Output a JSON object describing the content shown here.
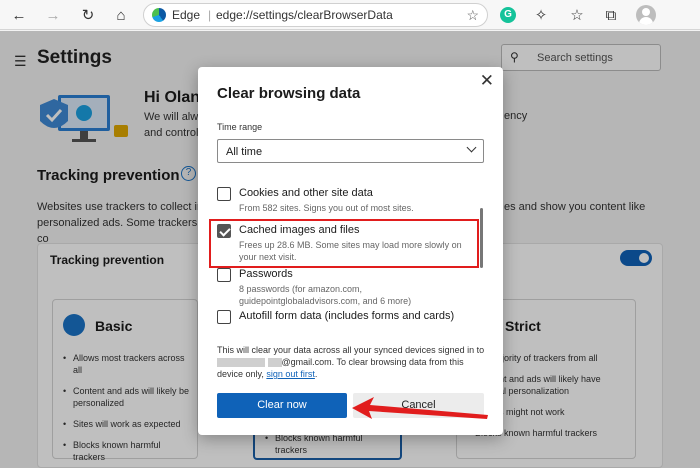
{
  "browser": {
    "brand": "Edge",
    "url": "edge://settings/clearBrowserData",
    "icons": [
      "back-icon",
      "forward-icon",
      "refresh-icon",
      "home-icon",
      "favorite-icon",
      "grammarly-icon",
      "extensions-icon",
      "favorites-icon",
      "collections-icon",
      "profile-icon"
    ],
    "grammarly_letter": "G"
  },
  "settings": {
    "title": "Settings",
    "search_placeholder": "Search settings",
    "greeting": "Hi Olan",
    "intro_text": "We will alw and control",
    "privacy_fragment": "ency",
    "tracking_heading": "Tracking prevention",
    "help_glyph": "?",
    "desc_left": "Websites use trackers to collect inf personalized ads. Some trackers co",
    "desc_right": "es and show you content like",
    "card_title": "Tracking prevention",
    "basic": {
      "title": "Basic",
      "items": [
        "Allows most trackers across all",
        "Content and ads will likely be personalized",
        "Sites will work as expected",
        "Blocks known harmful trackers"
      ]
    },
    "balanced": {
      "items": [
        "Blocks known harmful trackers"
      ]
    },
    "strict": {
      "title": "Strict",
      "items": [
        "s a majority of trackers from all",
        "Content and ads will likely have minimal personalization",
        "of sites might not work",
        "Blocks known harmful trackers"
      ]
    }
  },
  "dialog": {
    "title": "Clear browsing data",
    "time_range_label": "Time range",
    "time_range_value": "All time",
    "items": [
      {
        "title": "Cookies and other site data",
        "sub": "From 582 sites. Signs you out of most sites.",
        "checked": false
      },
      {
        "title": "Cached images and files",
        "sub": "Frees up 28.6 MB. Some sites may load more slowly on your next visit.",
        "checked": true
      },
      {
        "title": "Passwords",
        "sub": "8 passwords (for amazon.com, guidepointglobaladvisors.com, and 6 more)",
        "checked": false
      },
      {
        "title": "Autofill form data (includes forms and cards)",
        "sub": "",
        "checked": false
      }
    ],
    "footer_part1": "This will clear your data across all your synced devices signed in to",
    "footer_email": "@gmail.com",
    "footer_part2": ". To clear browsing data from this device only,",
    "footer_link": "sign out first",
    "footer_end": ".",
    "clear_button": "Clear now",
    "cancel_button": "Cancel"
  },
  "colors": {
    "accent": "#0f62b8",
    "highlight": "#e11d1d"
  }
}
